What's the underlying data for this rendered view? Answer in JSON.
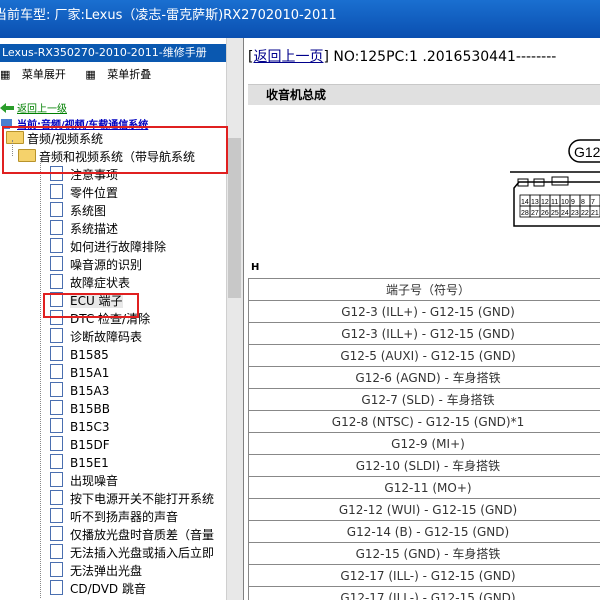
{
  "window": {
    "title": "当前车型:  厂家:Lexus（凌志-雷克萨斯)RX2702010-2011"
  },
  "left_panel": {
    "manual_title": "Lexus-RX350270-2010-2011-维修手册",
    "toolbar": {
      "expand": "菜单展开",
      "collapse": "菜单折叠"
    },
    "back_link": "返回上一级",
    "current_path": "当前:音频/视频/车载通信系统",
    "tree": [
      {
        "label": "音频/视频系统",
        "type": "folder",
        "level": 0
      },
      {
        "label": "音频和视频系统（带导航系统",
        "type": "folder",
        "level": 1
      },
      {
        "label": "注意事项",
        "type": "doc",
        "level": 2
      },
      {
        "label": "零件位置",
        "type": "doc",
        "level": 2
      },
      {
        "label": "系统图",
        "type": "doc",
        "level": 2
      },
      {
        "label": "系统描述",
        "type": "doc",
        "level": 2
      },
      {
        "label": "如何进行故障排除",
        "type": "doc",
        "level": 2
      },
      {
        "label": "噪音源的识别",
        "type": "doc",
        "level": 2
      },
      {
        "label": "故障症状表",
        "type": "doc",
        "level": 2
      },
      {
        "label": "ECU 端子",
        "type": "doc",
        "level": 2,
        "selected": true
      },
      {
        "label": "DTC 检查/清除",
        "type": "doc",
        "level": 2
      },
      {
        "label": "诊断故障码表",
        "type": "doc",
        "level": 2
      },
      {
        "label": "B1585",
        "type": "doc",
        "level": 2
      },
      {
        "label": "B15A1",
        "type": "doc",
        "level": 2
      },
      {
        "label": "B15A3",
        "type": "doc",
        "level": 2
      },
      {
        "label": "B15BB",
        "type": "doc",
        "level": 2
      },
      {
        "label": "B15C3",
        "type": "doc",
        "level": 2
      },
      {
        "label": "B15DF",
        "type": "doc",
        "level": 2
      },
      {
        "label": "B15E1",
        "type": "doc",
        "level": 2
      },
      {
        "label": "出现噪音",
        "type": "doc",
        "level": 2
      },
      {
        "label": "按下电源开关不能打开系统",
        "type": "doc",
        "level": 2
      },
      {
        "label": "听不到扬声器的声音",
        "type": "doc",
        "level": 2
      },
      {
        "label": "仅播放光盘时音质差（音量",
        "type": "doc",
        "level": 2
      },
      {
        "label": "无法插入光盘或插入后立即",
        "type": "doc",
        "level": 2
      },
      {
        "label": "无法弹出光盘",
        "type": "doc",
        "level": 2
      },
      {
        "label": "CD/DVD 跳音",
        "type": "doc",
        "level": 2
      }
    ]
  },
  "document": {
    "back_link": "返回上一页",
    "doc_number": "NO:125PC:1 .2016530441--------",
    "section_title": "收音机总成",
    "connector": {
      "label": "G12",
      "pins_top": [
        "14",
        "13",
        "12",
        "11",
        "10",
        "9",
        "8",
        "7"
      ],
      "pins_bottom": [
        "28",
        "27",
        "26",
        "25",
        "24",
        "23",
        "22",
        "21"
      ]
    },
    "table_label": "H",
    "table_header": "端子号（符号）",
    "rows": [
      "G12-3 (ILL+) - G12-15 (GND)",
      "G12-3 (ILL+) - G12-15 (GND)",
      "G12-5 (AUXI) - G12-15 (GND)",
      "G12-6 (AGND) - 车身搭铁",
      "G12-7 (SLD) - 车身搭铁",
      "G12-8 (NTSC) - G12-15 (GND)*1",
      "G12-9 (MI+)",
      "G12-10 (SLDI) - 车身搭铁",
      "G12-11 (MO+)",
      "G12-12 (WUI) - G12-15 (GND)",
      "G12-14 (B) - G12-15 (GND)",
      "G12-15 (GND) - 车身搭铁",
      "G12-17 (ILL-) - G12-15 (GND)",
      "G12-17 (ILL-) - G12-15 (GND)"
    ]
  },
  "colors": {
    "title_bar": "#0a58b0",
    "highlight_box": "#e02020",
    "section_bar": "#e0e0e0"
  }
}
